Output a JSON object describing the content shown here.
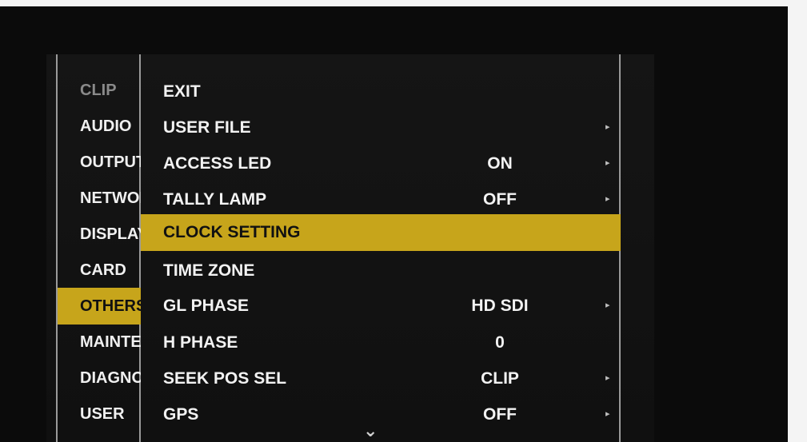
{
  "parent_menu": {
    "items": [
      {
        "label": "CLIP"
      },
      {
        "label": "AUDIO"
      },
      {
        "label": "OUTPUT"
      },
      {
        "label": "NETWORK"
      },
      {
        "label": "DISPLAY"
      },
      {
        "label": "CARD"
      },
      {
        "label": "OTHERS"
      },
      {
        "label": "MAINTENANCE"
      },
      {
        "label": "DIAGNOSTIC"
      },
      {
        "label": "USER"
      }
    ],
    "selected": "OTHERS"
  },
  "sub_menu": {
    "items": [
      {
        "label": "EXIT",
        "value": ""
      },
      {
        "label": "USER FILE",
        "value": ""
      },
      {
        "label": "ACCESS LED",
        "value": "ON"
      },
      {
        "label": "TALLY LAMP",
        "value": "OFF"
      },
      {
        "label": "CLOCK SETTING",
        "value": ""
      },
      {
        "label": "TIME ZONE",
        "value": ""
      },
      {
        "label": "GL PHASE",
        "value": "HD SDI"
      },
      {
        "label": "H PHASE",
        "value": "0"
      },
      {
        "label": "SEEK POS SEL",
        "value": "CLIP"
      },
      {
        "label": "GPS",
        "value": "OFF"
      }
    ],
    "selected": "CLOCK SETTING"
  },
  "icons": {
    "submenu_arrow": "▸",
    "scroll_down": "⌄"
  },
  "colors": {
    "highlight": "#c7a51b",
    "background": "#0e0e0e",
    "text": "#f0f0f0",
    "dim_text": "#8a8a8a"
  }
}
